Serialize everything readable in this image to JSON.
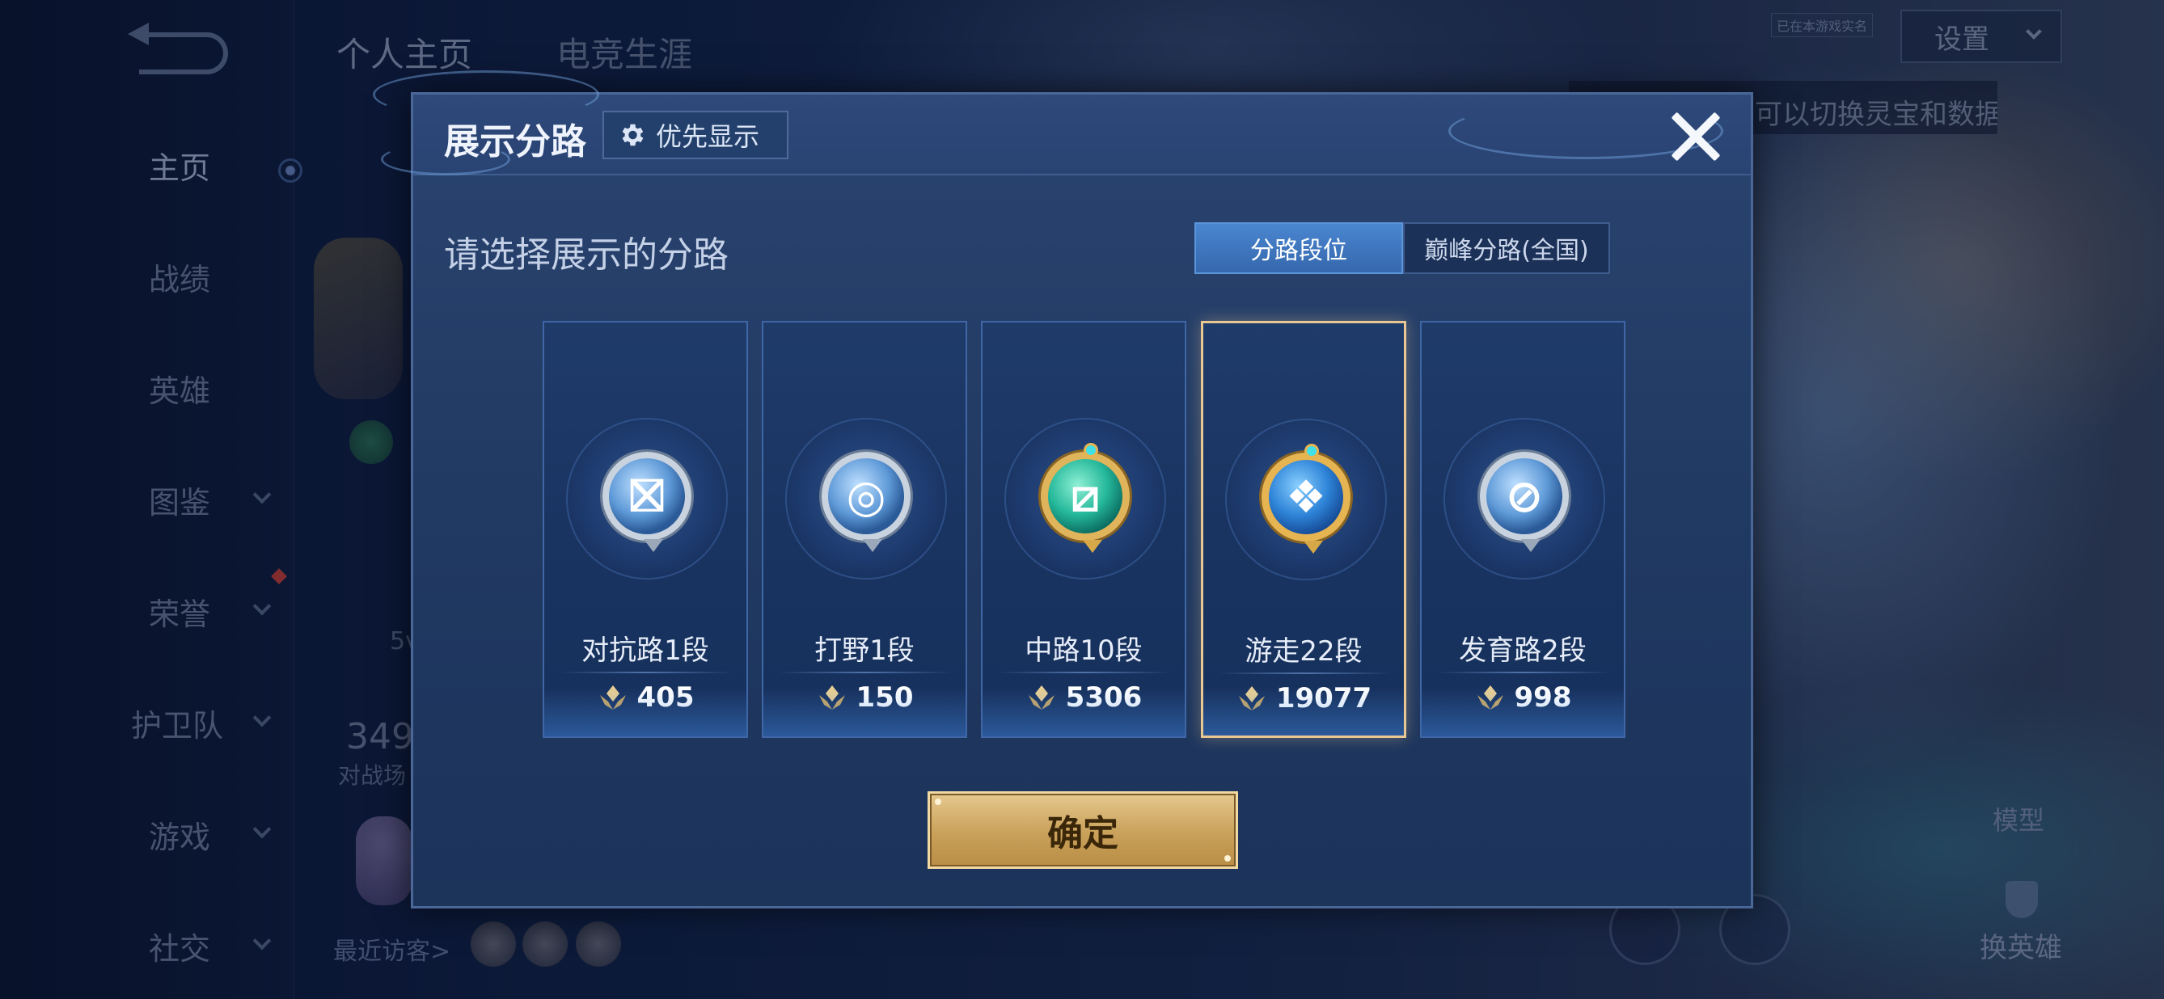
{
  "background": {
    "top_tabs": [
      "个人主页",
      "电竞生涯"
    ],
    "settings_label": "设置",
    "tiny_badge": "已在本游戏实名",
    "hint_text": "可以切换灵宝和数据展示",
    "left_nav": [
      {
        "label": "主页",
        "has_chevron": false
      },
      {
        "label": "战绩",
        "has_chevron": false
      },
      {
        "label": "英雄",
        "has_chevron": false
      },
      {
        "label": "图鉴",
        "has_chevron": true
      },
      {
        "label": "荣誉",
        "has_chevron": true
      },
      {
        "label": "护卫队",
        "has_chevron": true
      },
      {
        "label": "游戏",
        "has_chevron": true
      },
      {
        "label": "社交",
        "has_chevron": true
      }
    ],
    "stat_number": "349",
    "stat_label": "对战场",
    "fivev_text": "5v",
    "recent_visitors": "最近访客>",
    "model_label": "模型",
    "swap_hero_label": "换英雄"
  },
  "modal": {
    "title": "展示分路",
    "priority_label": "优先显示",
    "subtitle": "请选择展示的分路",
    "segments": [
      {
        "label": "分路段位",
        "active": true
      },
      {
        "label": "巅峰分路(全国)",
        "active": false
      }
    ],
    "lanes": [
      {
        "name": "对抗路1段",
        "score": "405",
        "icon": "clash-lane-emblem-icon",
        "tier": "silver",
        "selected": false
      },
      {
        "name": "打野1段",
        "score": "150",
        "icon": "jungle-dragon-emblem-icon",
        "tier": "silver",
        "selected": false
      },
      {
        "name": "中路10段",
        "score": "5306",
        "icon": "mid-lane-emblem-icon",
        "tier": "gold",
        "selected": false
      },
      {
        "name": "游走22段",
        "score": "19077",
        "icon": "roam-wings-emblem-icon",
        "tier": "gold-blue",
        "selected": true
      },
      {
        "name": "发育路2段",
        "score": "998",
        "icon": "farm-lane-emblem-icon",
        "tier": "silver",
        "selected": false
      }
    ],
    "confirm_label": "确定"
  },
  "colors": {
    "accent_blue": "#3f7cc8",
    "selected_border": "#e8c792",
    "confirm_gold": "#c9a15a",
    "modal_bg": "#233d68"
  }
}
